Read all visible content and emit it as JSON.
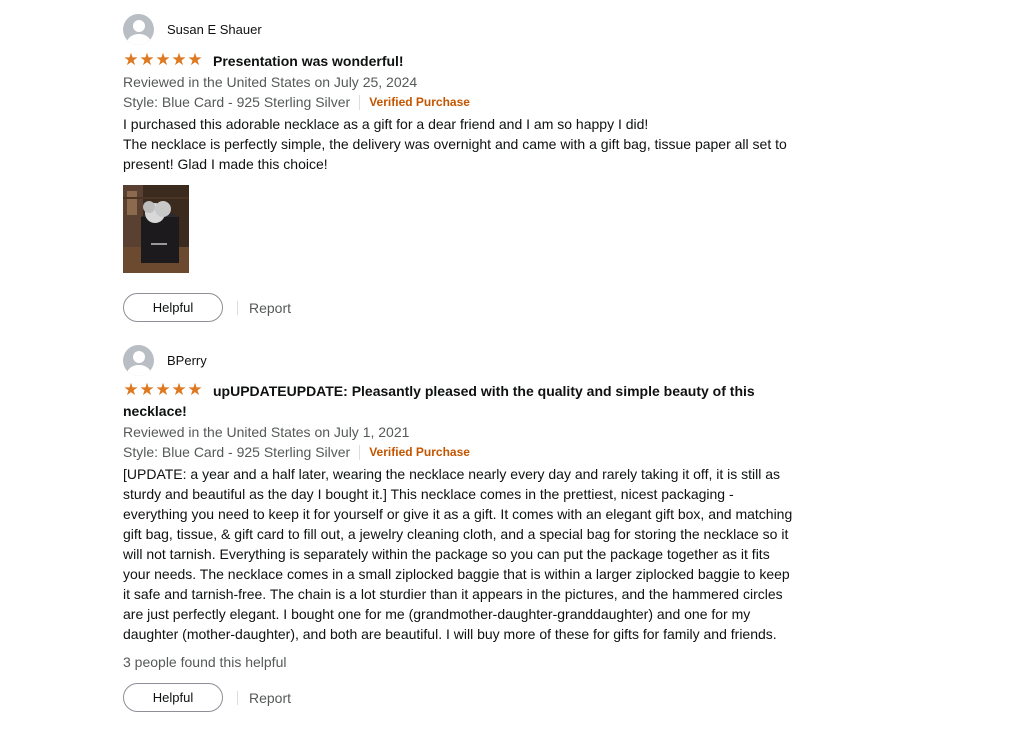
{
  "reviews": [
    {
      "author": "Susan E Shauer",
      "rating": 5,
      "title": "Presentation was wonderful!",
      "date": "Reviewed in the United States on July 25, 2024",
      "style": "Style: Blue Card - 925 Sterling Silver",
      "verified": "Verified Purchase",
      "body": [
        "I purchased this adorable necklace as a gift for a dear friend and I am so happy I did!",
        "The necklace is perfectly simple, the delivery was overnight and came with a gift bag, tissue paper all set to present! Glad I made this choice!"
      ],
      "helpful_label": "Helpful",
      "report_label": "Report"
    },
    {
      "author": "BPerry",
      "rating": 5,
      "title": "upUPDATEUPDATE: Pleasantly pleased with the quality and simple beauty of this necklace!",
      "date": "Reviewed in the United States on July 1, 2021",
      "style": "Style: Blue Card - 925 Sterling Silver",
      "verified": "Verified Purchase",
      "body": [
        "[UPDATE: a year and a half later, wearing the necklace nearly every day and rarely taking it off, it is still as sturdy and beautiful as the day I bought it.] This necklace comes in the prettiest, nicest packaging - everything you need to keep it for yourself or give it as a gift. It comes with an elegant gift box, and matching gift bag, tissue, & gift card to fill out, a jewelry cleaning cloth, and a special bag for storing the necklace so it will not tarnish. Everything is separately within the package so you can put the package together as it fits your needs. The necklace comes in a small ziplocked baggie that is within a larger ziplocked baggie to keep it safe and tarnish-free. The chain is a lot sturdier than it appears in the pictures, and the hammered circles are just perfectly elegant. I bought one for me (grandmother-daughter-granddaughter) and one for my daughter (mother-daughter), and both are beautiful. I will buy more of these for gifts for family and friends."
      ],
      "helpful_count_text": "3 people found this helpful",
      "helpful_label": "Helpful",
      "report_label": "Report"
    }
  ],
  "colors": {
    "star": "#de7921",
    "verified": "#c45500",
    "muted": "#565959",
    "text": "#0f1111"
  },
  "icons": {
    "avatar": "default-user-avatar-icon",
    "star": "star-icon"
  }
}
